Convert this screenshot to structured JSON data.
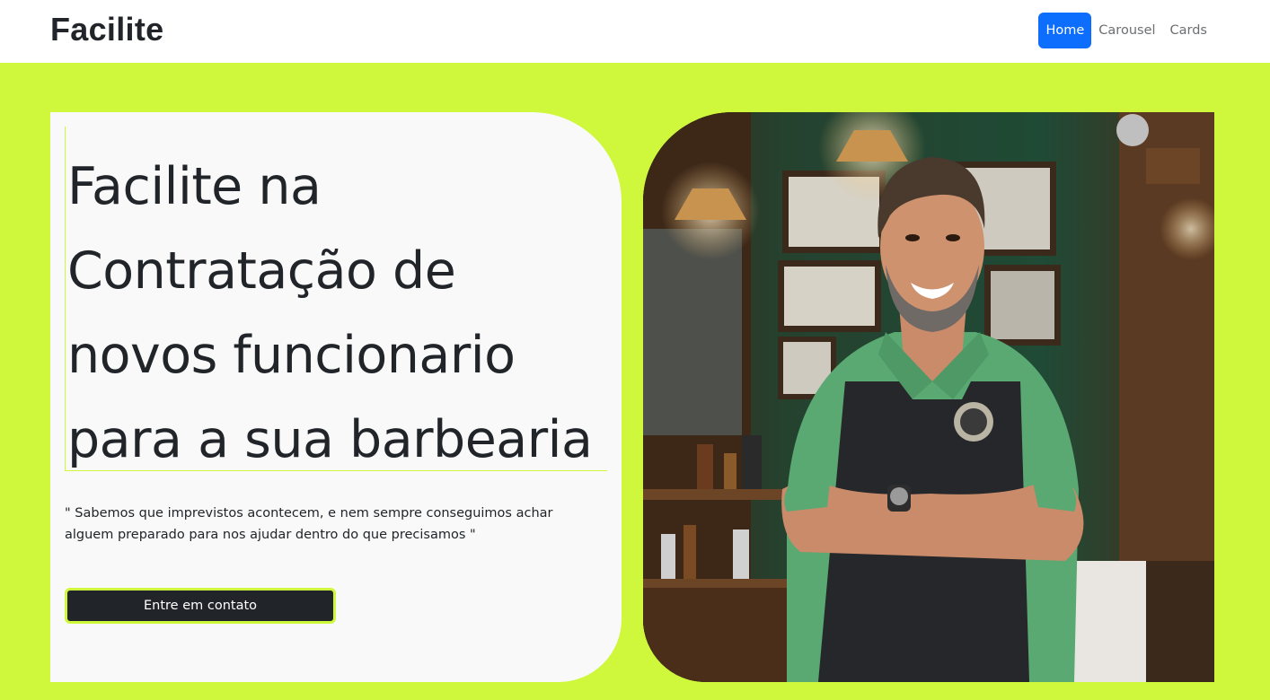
{
  "navbar": {
    "brand": "Facilite",
    "links": [
      {
        "label": "Home",
        "active": true
      },
      {
        "label": "Carousel",
        "active": false
      },
      {
        "label": "Cards",
        "active": false
      }
    ]
  },
  "hero": {
    "headline": "Facilite na Contratação de novos funcionario para a sua barbearia",
    "quote": "\" Sabemos que imprevistos acontecem, e nem sempre conseguimos achar alguem preparado para nos ajudar dentro do que precisamos \"",
    "cta_label": "Entre em contato"
  },
  "colors": {
    "accent": "#cff73c",
    "primary": "#0d6efd",
    "dark": "#212529"
  }
}
